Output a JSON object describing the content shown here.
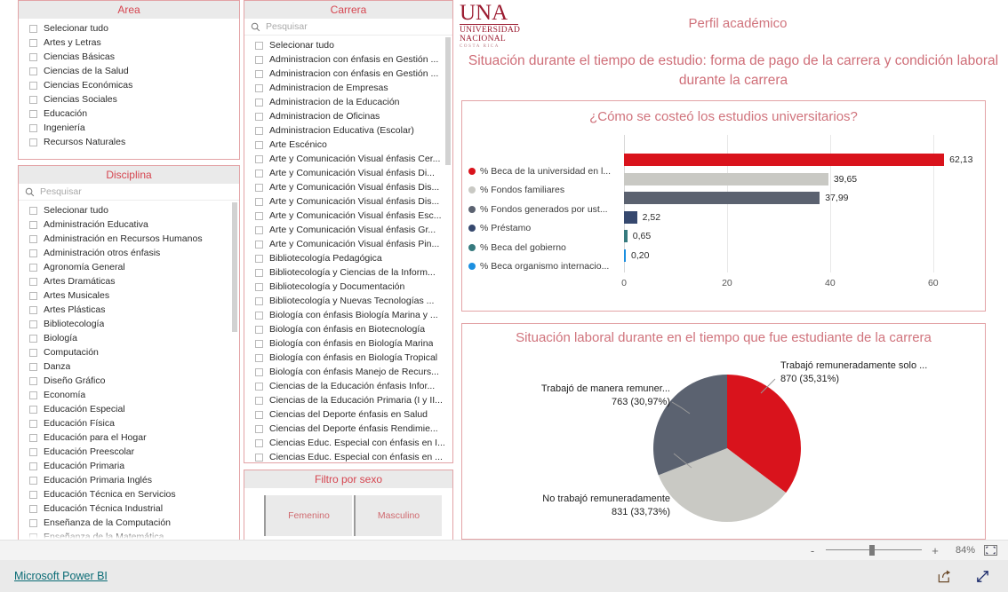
{
  "header": {
    "logo": {
      "main": "UNA",
      "line1": "UNIVERSIDAD",
      "line2": "NACIONAL",
      "line3": "COSTA RICA"
    },
    "title": "Perfil académico",
    "subtitle": "Situación durante el tiempo de estudio: forma de pago de la carrera y condición laboral durante la carrera"
  },
  "area_slicer": {
    "title": "Area",
    "items": [
      "Selecionar tudo",
      "Artes y Letras",
      "Ciencias Básicas",
      "Ciencias de la Salud",
      "Ciencias Económicas",
      "Ciencias Sociales",
      "Educación",
      "Ingeniería",
      "Recursos Naturales"
    ]
  },
  "disciplina_slicer": {
    "title": "Disciplina",
    "search_placeholder": "Pesquisar",
    "items": [
      "Selecionar tudo",
      "Administración Educativa",
      "Administración en Recursos Humanos",
      "Administración otros énfasis",
      "Agronomía General",
      "Artes Dramáticas",
      "Artes Musicales",
      "Artes Plásticas",
      "Bibliotecología",
      "Biología",
      "Computación",
      "Danza",
      "Diseño Gráfico",
      "Economía",
      "Educación Especial",
      "Educación Física",
      "Educación para el Hogar",
      "Educación Preescolar",
      "Educación Primaria",
      "Educación Primaria Inglés",
      "Educación Técnica en Servicios",
      "Educación Técnica Industrial",
      "Enseñanza de la Computación",
      "Enseñanza de la Matemática"
    ]
  },
  "carrera_slicer": {
    "title": "Carrera",
    "search_placeholder": "Pesquisar",
    "items": [
      "Selecionar tudo",
      "Administracion con énfasis en Gestión ...",
      "Administracion con énfasis en Gestión ...",
      "Administracion de Empresas",
      "Administracion de la Educación",
      "Administracion de Oficinas",
      "Administracion Educativa (Escolar)",
      "Arte Escénico",
      "Arte y Comunicación Visual énfasis Cer...",
      "Arte y Comunicación Visual énfasis Di...",
      "Arte y Comunicación Visual énfasis Dis...",
      "Arte y Comunicación Visual énfasis Dis...",
      "Arte y Comunicación Visual énfasis Esc...",
      "Arte y Comunicación Visual énfasis Gr...",
      "Arte y Comunicación Visual énfasis Pin...",
      "Bibliotecología Pedagógica",
      "Bibliotecología y Ciencias de la Inform...",
      "Bibliotecología y Documentación",
      "Bibliotecología y Nuevas Tecnologías ...",
      "Biología con énfasis Biología Marina y ...",
      "Biología con énfasis en Biotecnología",
      "Biología con énfasis en Biología Marina",
      "Biología con énfasis en Biología Tropical",
      "Biología con énfasis Manejo de Recurs...",
      "Ciencias de la Educación énfasis Infor...",
      "Ciencias de la Educación Primaria (I y II...",
      "Ciencias del Deporte énfasis en Salud",
      "Ciencias del Deporte énfasis Rendimie...",
      "Ciencias Educ. Especial con énfasis en I...",
      "Ciencias Educ. Especial con énfasis en ..."
    ]
  },
  "sexo_slicer": {
    "title": "Filtro por sexo",
    "options": [
      "Femenino",
      "Masculino"
    ]
  },
  "statusbar": {
    "zoom_minus": "-",
    "zoom_plus": "+",
    "zoom_percent": "84%",
    "fit_icon": "fit-to-page-icon"
  },
  "footer": {
    "brand": "Microsoft Power BI",
    "share_icon": "share-icon",
    "fullscreen_icon": "fullscreen-icon"
  },
  "chart_data": [
    {
      "type": "bar",
      "orientation": "horizontal",
      "title": "¿Cómo se costeó los estudios universitarios?",
      "xlabel": "",
      "ylabel": "",
      "xlim": [
        0,
        69
      ],
      "xticks": [
        0,
        20,
        40,
        60
      ],
      "grid": true,
      "legend_position": "left",
      "categories": [
        "% Beca de la universidad en l...",
        "% Fondos familiares",
        "% Fondos generados por ust...",
        "% Préstamo",
        "% Beca del gobierno",
        "% Beca organismo internacio..."
      ],
      "values": [
        62.13,
        39.65,
        37.99,
        2.52,
        0.65,
        0.2
      ],
      "value_labels": [
        "62,13",
        "39,65",
        "37,99",
        "2,52",
        "0,65",
        "0,20"
      ],
      "colors": [
        "#d9131c",
        "#c9c9c4",
        "#5b6270",
        "#36486e",
        "#367a7e",
        "#1b8fe0"
      ]
    },
    {
      "type": "pie",
      "title": "Situación laboral durante en el tiempo que fue estudiante de la carrera",
      "labels": [
        "Trabajó remuneradamente solo ...",
        "No trabajó remuneradamente",
        "Trabajó de manera remuner..."
      ],
      "values": [
        870,
        831,
        763
      ],
      "percents": [
        "35,31%",
        "33,73%",
        "30,97%"
      ],
      "value_labels": [
        "870 (35,31%)",
        "831 (33,73%)",
        "763 (30,97%)"
      ],
      "colors": [
        "#d9131c",
        "#c9c9c4",
        "#5b6270"
      ]
    }
  ]
}
